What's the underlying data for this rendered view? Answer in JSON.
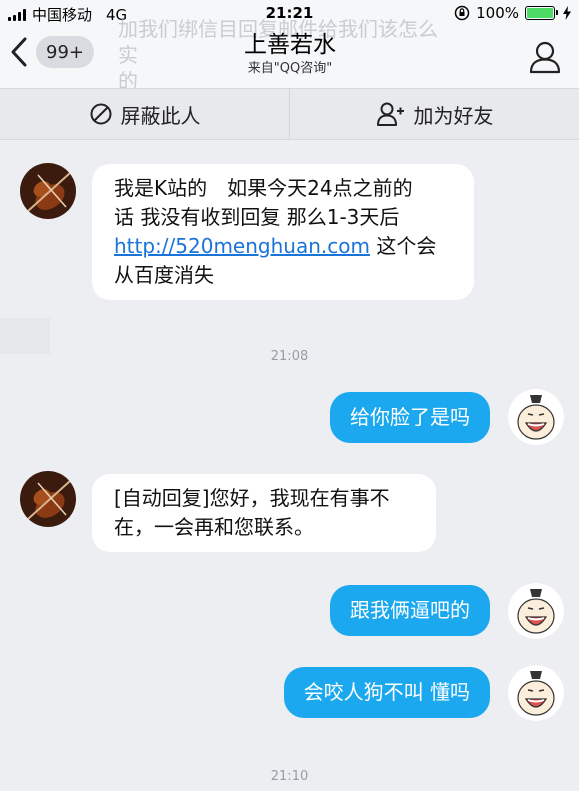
{
  "status_bar": {
    "carrier": "中国移动",
    "network": "4G",
    "time": "21:21",
    "battery": "100%",
    "battery_level": 1.0,
    "icons": [
      "signal-icon",
      "orientation-lock-icon",
      "battery-icon",
      "charging-bolt-icon"
    ]
  },
  "nav": {
    "unread_badge": "99+",
    "title": "上善若水",
    "subtitle": "来自\"QQ咨询\"",
    "ghost_text_line1": "加我们绑信目回复邮件给我们该怎么实",
    "ghost_text_line2": "的"
  },
  "actions": {
    "block_label": "屏蔽此人",
    "add_friend_label": "加为好友"
  },
  "messages": [
    {
      "side": "left",
      "lines": [
        "我是K站的　如果今天24点之前的",
        "话  我没有收到回复  那么1-3天后"
      ],
      "link": "http://520menghuan.com",
      "after_link": " 这个会",
      "last_line": "从百度消失"
    },
    {
      "timestamp": "21:08"
    },
    {
      "side": "right",
      "text": "给你脸了是吗"
    },
    {
      "side": "left",
      "lines": [
        "[自动回复]您好，我现在有事不",
        "在，一会再和您联系。"
      ]
    },
    {
      "side": "right",
      "text": "跟我俩逼吧的"
    },
    {
      "side": "right",
      "text": "会咬人狗不叫 懂吗"
    },
    {
      "timestamp": "21:10"
    }
  ],
  "colors": {
    "bubble_blue": "#1ba8ef",
    "link_blue": "#1a74d8",
    "background": "#eceef2"
  }
}
